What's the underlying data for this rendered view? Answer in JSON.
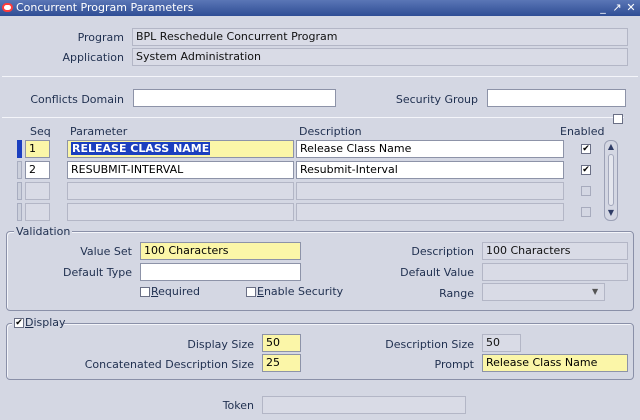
{
  "window": {
    "title": "Concurrent Program Parameters",
    "buttons": {
      "minimize": "_",
      "maximize": "↗",
      "close": "✕"
    }
  },
  "header": {
    "program_label": "Program",
    "program_value": "BPL Reschedule Concurrent Program",
    "application_label": "Application",
    "application_value": "System Administration",
    "conflicts_label": "Conflicts Domain",
    "conflicts_value": "",
    "security_label": "Security Group",
    "security_value": ""
  },
  "table": {
    "headers": {
      "seq": "Seq",
      "parameter": "Parameter",
      "description": "Description",
      "enabled": "Enabled"
    },
    "rows": [
      {
        "seq": "1",
        "parameter": "RELEASE CLASS NAME",
        "description": "Release Class Name",
        "enabled": "✔"
      },
      {
        "seq": "2",
        "parameter": "RESUBMIT-INTERVAL",
        "description": "Resubmit-Interval",
        "enabled": "✔"
      },
      {
        "seq": "",
        "parameter": "",
        "description": "",
        "enabled": ""
      },
      {
        "seq": "",
        "parameter": "",
        "description": "",
        "enabled": ""
      }
    ]
  },
  "validation": {
    "title": "Validation",
    "value_set_label": "Value Set",
    "value_set": "100 Characters",
    "default_type_label": "Default Type",
    "default_type": "",
    "description_label": "Description",
    "description": "100 Characters",
    "default_value_label": "Default Value",
    "default_value": "",
    "range_label": "Range",
    "range": "",
    "required_pre": "",
    "required_u": "R",
    "required_post": "equired",
    "enable_security_pre": "",
    "enable_security_u": "E",
    "enable_security_post": "nable Security"
  },
  "display": {
    "title_u": "D",
    "title_post": "isplay",
    "checked": "✔",
    "display_size_label": "Display Size",
    "display_size": "50",
    "concat_label": "Concatenated Description Size",
    "concat_size": "25",
    "description_size_label": "Description Size",
    "description_size": "50",
    "prompt_label": "Prompt",
    "prompt": "Release Class Name"
  },
  "token": {
    "label": "Token",
    "value": ""
  }
}
